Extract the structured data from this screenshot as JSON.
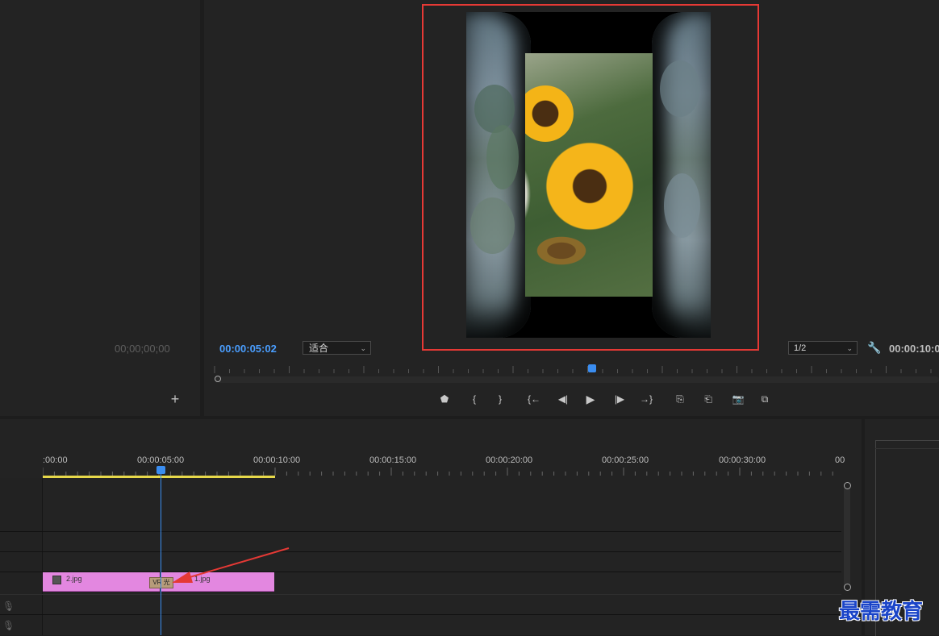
{
  "source_monitor": {
    "timecode": "00;00;00;00",
    "add_label": "+"
  },
  "program_monitor": {
    "timecode": "00:00:05:02",
    "fit_label": "适合",
    "resolution_label": "1/2",
    "duration": "00:00:10:0"
  },
  "controls": [
    {
      "name": "add-marker-button",
      "glyph": "⬟"
    },
    {
      "name": "mark-in-button",
      "glyph": "{"
    },
    {
      "name": "mark-out-button",
      "glyph": "}"
    },
    {
      "name": "go-to-in-button",
      "glyph": "{←"
    },
    {
      "name": "step-back-button",
      "glyph": "◀|"
    },
    {
      "name": "play-button",
      "glyph": "▶"
    },
    {
      "name": "step-forward-button",
      "glyph": "|▶"
    },
    {
      "name": "go-to-out-button",
      "glyph": "→}"
    },
    {
      "name": "lift-button",
      "glyph": "⎘"
    },
    {
      "name": "extract-button",
      "glyph": "⎗"
    },
    {
      "name": "export-frame-button",
      "glyph": "📷"
    },
    {
      "name": "comparison-view-button",
      "glyph": "⧉"
    }
  ],
  "timeline": {
    "ruler_labels": [
      ":00:00",
      "00:00:05:00",
      "00:00:10:00",
      "00:00:15:00",
      "00:00:20:00",
      "00:00:25:00",
      "00:00:30:00",
      "00"
    ],
    "clips": [
      {
        "label": "2.jpg"
      },
      {
        "label": "1.jpg"
      }
    ],
    "transition_label": "VR 光"
  },
  "icons": {
    "mic": "mic-icon",
    "wrench": "wrench-icon"
  },
  "colors": {
    "accent": "#3a8df0",
    "clip": "#e387e0",
    "work_area": "#e6d84a",
    "highlight_box": "#e53935",
    "arrow": "#e53935"
  },
  "watermark": "最需教育"
}
